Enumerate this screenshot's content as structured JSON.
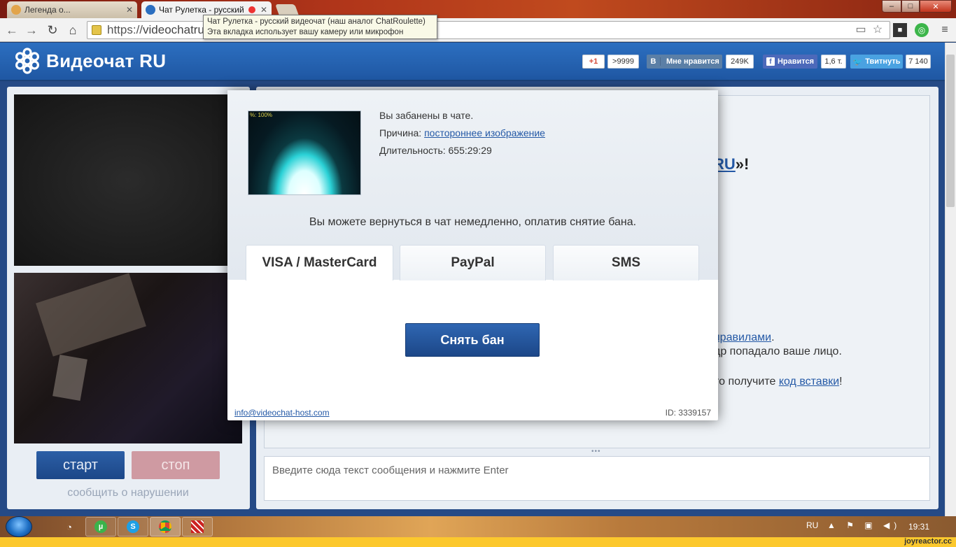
{
  "browser": {
    "tabs": [
      {
        "title": "Легенда о...",
        "close": "✕"
      },
      {
        "title": "Чат Рулетка - русский",
        "close": "✕"
      }
    ],
    "url_scheme": "https://",
    "url_host": "videochatru.c",
    "tooltip_line1": "Чат Рулетка - русский видеочат (наш аналог ChatRoulette)",
    "tooltip_line2": "Эта вкладка использует вашу камеру или микрофон",
    "nav_back": "←",
    "nav_forward": "→",
    "nav_reload": "↻",
    "nav_home": "⌂",
    "window_min": "–",
    "window_max": "□",
    "window_close": "✕"
  },
  "site": {
    "logo": "Видеочат RU",
    "social": {
      "gplus": "+1",
      "gplus_count": ">9999",
      "vk_letter": "В",
      "vk": "Мне нравится",
      "vk_count": "249K",
      "fb": "Нравится",
      "fb_count": "1,6 т.",
      "tw": "Твитнуть",
      "tw_count": "7 140"
    },
    "controls": {
      "start": "старт",
      "stop": "стоп",
      "report": "сообщить о нарушении"
    },
    "chat": {
      "welcome_link": "RU",
      "welcome_tail": "»!",
      "rules_link": "правилами",
      "rules_tail": ".",
      "face_text": "др попадало ваше лицо.",
      "code_pre": "то получите ",
      "code_link": "код вставки",
      "code_tail": "!",
      "input_placeholder": "Введите сюда текст сообщения и нажмите Enter",
      "resize_handle": "•••"
    }
  },
  "modal": {
    "thumb_label": "%: 100%",
    "banned": "Вы забанены в чате.",
    "reason_label": "Причина: ",
    "reason_value": "постороннее изображение",
    "duration_label": "Длительность: ",
    "duration_value": "655:29:29",
    "pay_message": "Вы можете вернуться в чат немедленно, оплатив снятие бана.",
    "tabs": [
      "VISA / MasterCard",
      "PayPal",
      "SMS"
    ],
    "unban_button": "Снять бан",
    "email": "info@videochat-host.com",
    "id_text": "ID: 3339157"
  },
  "taskbar": {
    "lang": "RU",
    "clock": "19:31",
    "tray": "▲ ⚑ ▣ ◀)"
  },
  "watermark": "joyreactor.cc",
  "colors": {
    "header_blue": "#2c6fc0",
    "button_blue": "#1c4788",
    "stop_pink": "#cf9aa2",
    "link": "#2459a6"
  }
}
